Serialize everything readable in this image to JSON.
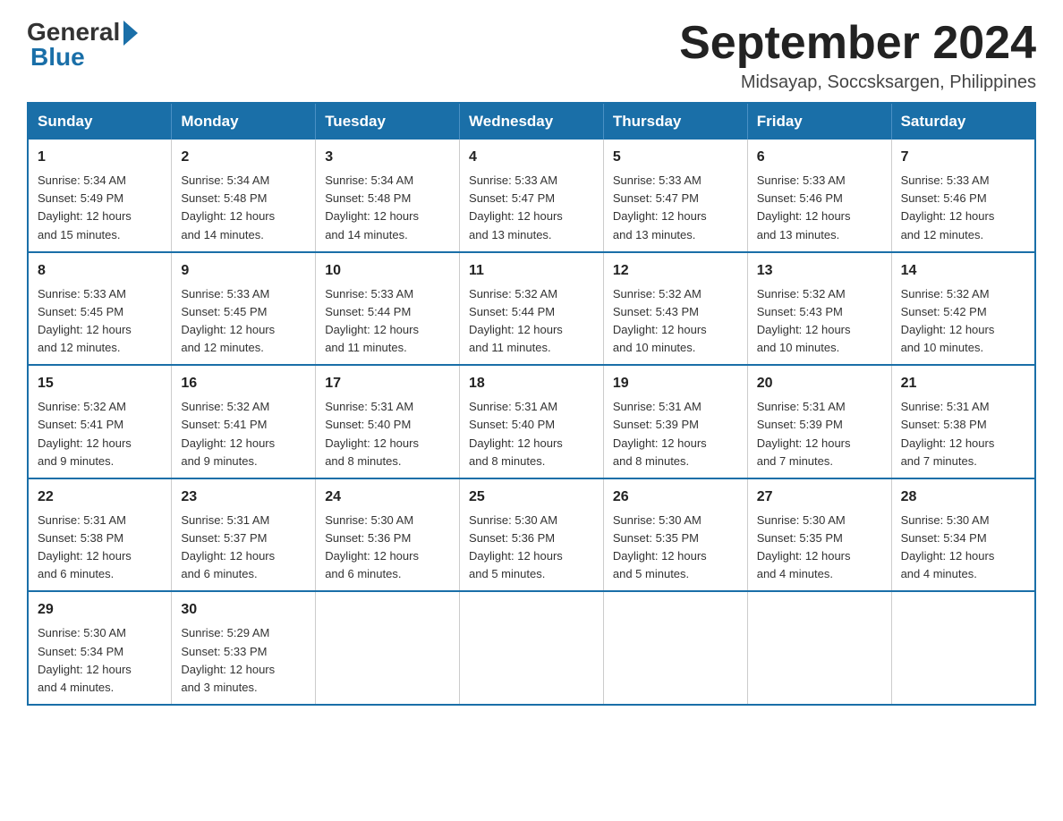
{
  "header": {
    "logo_general": "General",
    "logo_blue": "Blue",
    "month_title": "September 2024",
    "location": "Midsayap, Soccsksargen, Philippines"
  },
  "weekdays": [
    "Sunday",
    "Monday",
    "Tuesday",
    "Wednesday",
    "Thursday",
    "Friday",
    "Saturday"
  ],
  "weeks": [
    [
      {
        "day": "1",
        "sunrise": "5:34 AM",
        "sunset": "5:49 PM",
        "daylight": "12 hours and 15 minutes."
      },
      {
        "day": "2",
        "sunrise": "5:34 AM",
        "sunset": "5:48 PM",
        "daylight": "12 hours and 14 minutes."
      },
      {
        "day": "3",
        "sunrise": "5:34 AM",
        "sunset": "5:48 PM",
        "daylight": "12 hours and 14 minutes."
      },
      {
        "day": "4",
        "sunrise": "5:33 AM",
        "sunset": "5:47 PM",
        "daylight": "12 hours and 13 minutes."
      },
      {
        "day": "5",
        "sunrise": "5:33 AM",
        "sunset": "5:47 PM",
        "daylight": "12 hours and 13 minutes."
      },
      {
        "day": "6",
        "sunrise": "5:33 AM",
        "sunset": "5:46 PM",
        "daylight": "12 hours and 13 minutes."
      },
      {
        "day": "7",
        "sunrise": "5:33 AM",
        "sunset": "5:46 PM",
        "daylight": "12 hours and 12 minutes."
      }
    ],
    [
      {
        "day": "8",
        "sunrise": "5:33 AM",
        "sunset": "5:45 PM",
        "daylight": "12 hours and 12 minutes."
      },
      {
        "day": "9",
        "sunrise": "5:33 AM",
        "sunset": "5:45 PM",
        "daylight": "12 hours and 12 minutes."
      },
      {
        "day": "10",
        "sunrise": "5:33 AM",
        "sunset": "5:44 PM",
        "daylight": "12 hours and 11 minutes."
      },
      {
        "day": "11",
        "sunrise": "5:32 AM",
        "sunset": "5:44 PM",
        "daylight": "12 hours and 11 minutes."
      },
      {
        "day": "12",
        "sunrise": "5:32 AM",
        "sunset": "5:43 PM",
        "daylight": "12 hours and 10 minutes."
      },
      {
        "day": "13",
        "sunrise": "5:32 AM",
        "sunset": "5:43 PM",
        "daylight": "12 hours and 10 minutes."
      },
      {
        "day": "14",
        "sunrise": "5:32 AM",
        "sunset": "5:42 PM",
        "daylight": "12 hours and 10 minutes."
      }
    ],
    [
      {
        "day": "15",
        "sunrise": "5:32 AM",
        "sunset": "5:41 PM",
        "daylight": "12 hours and 9 minutes."
      },
      {
        "day": "16",
        "sunrise": "5:32 AM",
        "sunset": "5:41 PM",
        "daylight": "12 hours and 9 minutes."
      },
      {
        "day": "17",
        "sunrise": "5:31 AM",
        "sunset": "5:40 PM",
        "daylight": "12 hours and 8 minutes."
      },
      {
        "day": "18",
        "sunrise": "5:31 AM",
        "sunset": "5:40 PM",
        "daylight": "12 hours and 8 minutes."
      },
      {
        "day": "19",
        "sunrise": "5:31 AM",
        "sunset": "5:39 PM",
        "daylight": "12 hours and 8 minutes."
      },
      {
        "day": "20",
        "sunrise": "5:31 AM",
        "sunset": "5:39 PM",
        "daylight": "12 hours and 7 minutes."
      },
      {
        "day": "21",
        "sunrise": "5:31 AM",
        "sunset": "5:38 PM",
        "daylight": "12 hours and 7 minutes."
      }
    ],
    [
      {
        "day": "22",
        "sunrise": "5:31 AM",
        "sunset": "5:38 PM",
        "daylight": "12 hours and 6 minutes."
      },
      {
        "day": "23",
        "sunrise": "5:31 AM",
        "sunset": "5:37 PM",
        "daylight": "12 hours and 6 minutes."
      },
      {
        "day": "24",
        "sunrise": "5:30 AM",
        "sunset": "5:36 PM",
        "daylight": "12 hours and 6 minutes."
      },
      {
        "day": "25",
        "sunrise": "5:30 AM",
        "sunset": "5:36 PM",
        "daylight": "12 hours and 5 minutes."
      },
      {
        "day": "26",
        "sunrise": "5:30 AM",
        "sunset": "5:35 PM",
        "daylight": "12 hours and 5 minutes."
      },
      {
        "day": "27",
        "sunrise": "5:30 AM",
        "sunset": "5:35 PM",
        "daylight": "12 hours and 4 minutes."
      },
      {
        "day": "28",
        "sunrise": "5:30 AM",
        "sunset": "5:34 PM",
        "daylight": "12 hours and 4 minutes."
      }
    ],
    [
      {
        "day": "29",
        "sunrise": "5:30 AM",
        "sunset": "5:34 PM",
        "daylight": "12 hours and 4 minutes."
      },
      {
        "day": "30",
        "sunrise": "5:29 AM",
        "sunset": "5:33 PM",
        "daylight": "12 hours and 3 minutes."
      },
      null,
      null,
      null,
      null,
      null
    ]
  ]
}
